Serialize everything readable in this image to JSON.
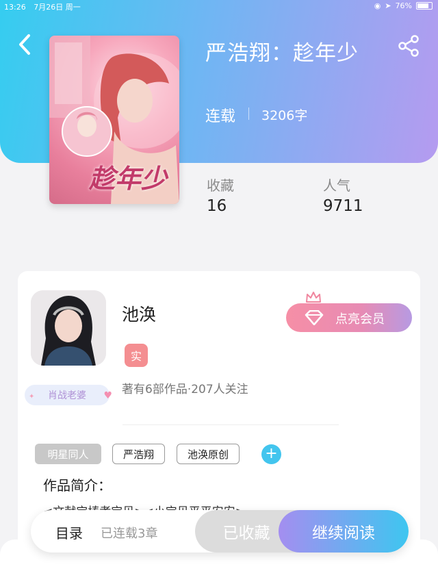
{
  "status_bar": {
    "time": "13:26",
    "date": "7月26日 周一",
    "battery": "76%"
  },
  "header": {
    "title": "严浩翔：趁年少",
    "status": "连载",
    "word_count": "3206字",
    "back_icon": "chevron-left-icon",
    "share_icon": "share-icon",
    "gradient": [
      "#35cdf0",
      "#b59bf0"
    ]
  },
  "cover": {
    "title_text": "趁年少"
  },
  "stats": [
    {
      "label": "收藏",
      "value": "16"
    },
    {
      "label": "人气",
      "value": "9711"
    }
  ],
  "author": {
    "name": "池涣",
    "verify_label": "实",
    "info": "著有6部作品·207人关注",
    "fan_tag": "肖战老婆",
    "vip_label": "点亮会员"
  },
  "tags": [
    {
      "label": "明星同人",
      "style": "filled"
    },
    {
      "label": "严浩翔",
      "style": "outline"
    },
    {
      "label": "池涣原创",
      "style": "outline"
    }
  ],
  "add_tag_label": "+",
  "intro": {
    "title": "作品简介：",
    "text": "<文献宝椿孝宝贝><小宝贝平平安安>"
  },
  "action_bar": {
    "toc_label": "目录",
    "chapters_label": "已连载3章",
    "collected_label": "已收藏",
    "read_label": "继续阅读"
  },
  "colors": {
    "accent_blue": "#3ec6f0",
    "accent_purple": "#a48ef0",
    "vip_pink": "#f68fa6"
  }
}
